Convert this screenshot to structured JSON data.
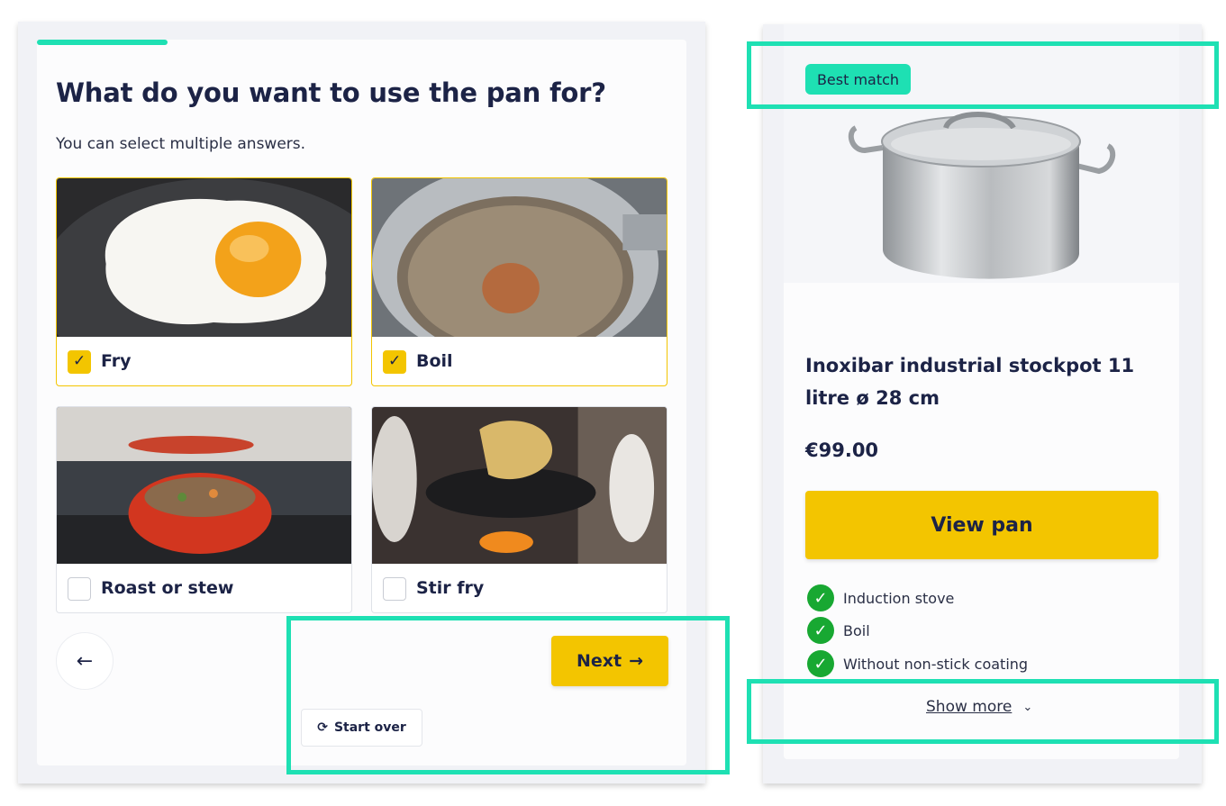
{
  "quiz": {
    "question": "What do you want to use the pan for?",
    "hint": "You can select multiple answers.",
    "options": [
      {
        "label": "Fry",
        "selected": true
      },
      {
        "label": "Boil",
        "selected": true
      },
      {
        "label": "Roast or stew",
        "selected": false
      },
      {
        "label": "Stir fry",
        "selected": false
      }
    ],
    "back_icon": "←",
    "next_label": "Next",
    "next_icon": "→",
    "start_over_label": "Start over",
    "start_over_icon": "⟳",
    "check_glyph": "✓"
  },
  "product": {
    "badge": "Best match",
    "title": "Inoxibar industrial stockpot 11 litre ø 28 cm",
    "price": "€99.00",
    "cta": "View pan",
    "features": [
      "Induction stove",
      "Boil",
      "Without non-stick coating"
    ],
    "feature_icon": "check-circle-icon",
    "show_more": "Show more",
    "show_more_icon": "⌄"
  },
  "colors": {
    "accent": "#1ee0b3",
    "button": "#f3c500",
    "text": "#1c2346",
    "success": "#18a832"
  }
}
